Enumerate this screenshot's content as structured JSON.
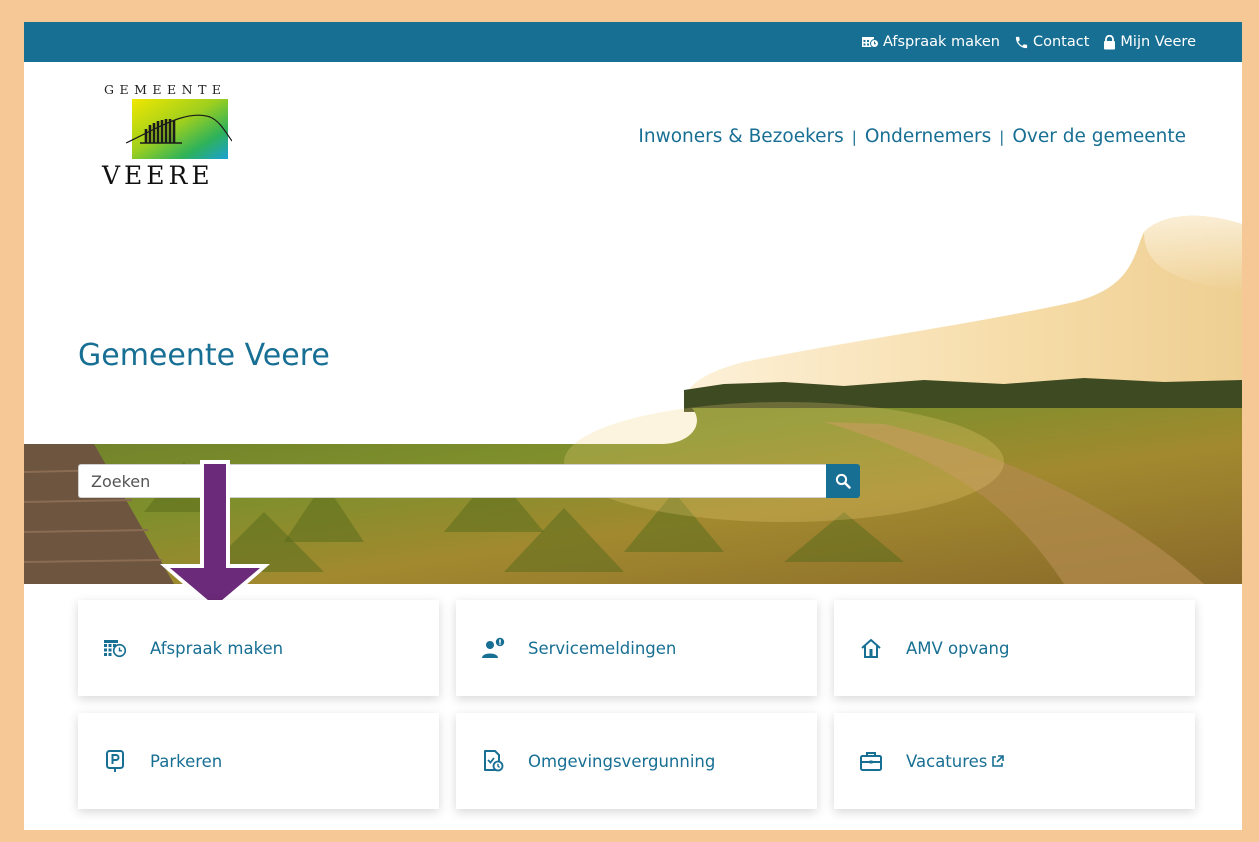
{
  "topbar": {
    "appointment": "Afspraak maken",
    "contact": "Contact",
    "account": "Mijn Veere"
  },
  "logo": {
    "top": "GEMEENTE",
    "bottom": "VEERE"
  },
  "nav": {
    "items": [
      "Inwoners & Bezoekers",
      "Ondernemers",
      "Over de gemeente"
    ],
    "separator": "|"
  },
  "hero": {
    "title": "Gemeente Veere"
  },
  "search": {
    "placeholder": "Zoeken"
  },
  "tiles": [
    {
      "label": "Afspraak maken",
      "icon": "calendar-clock-icon"
    },
    {
      "label": "Servicemeldingen",
      "icon": "person-alert-icon"
    },
    {
      "label": "AMV opvang",
      "icon": "home-icon"
    },
    {
      "label": "Parkeren",
      "icon": "parking-icon"
    },
    {
      "label": "Omgevingsvergunning",
      "icon": "permit-icon"
    },
    {
      "label": "Vacatures",
      "icon": "briefcase-icon"
    }
  ],
  "colors": {
    "brand": "#186f94",
    "frame": "#f5c896",
    "arrow": "#6b2a7a"
  }
}
